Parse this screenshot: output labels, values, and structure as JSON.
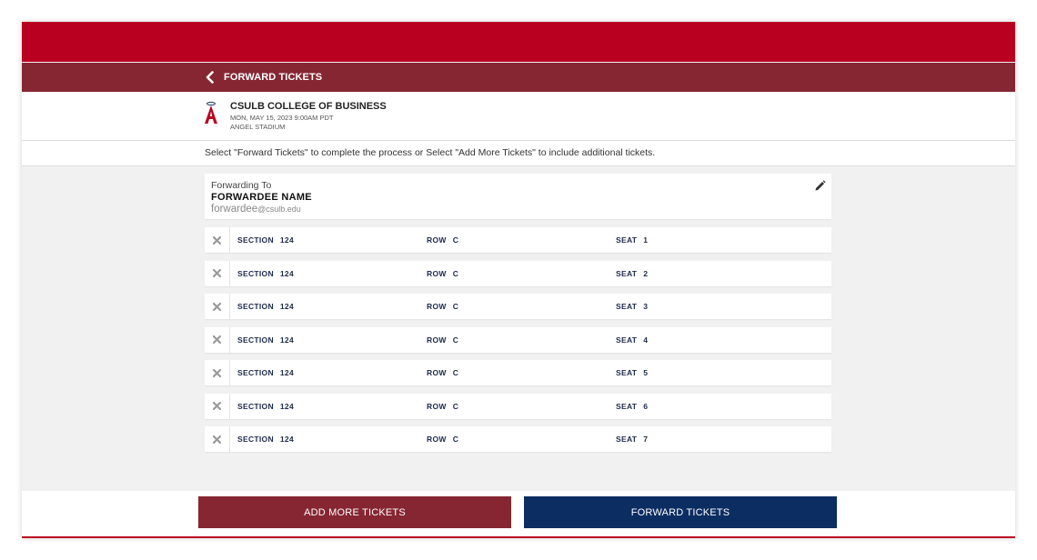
{
  "header": {
    "back_label": "FORWARD TICKETS"
  },
  "event": {
    "title": "CSULB COLLEGE OF BUSINESS",
    "date": "MON, MAY 15, 2023 9:00AM PDT",
    "venue": "ANGEL STADIUM",
    "logo_icon": "angels-a-halo-logo"
  },
  "instructions": "Select \"Forward Tickets\" to complete the process or Select \"Add More Tickets\" to include additional tickets.",
  "forwarding": {
    "label": "Forwarding To",
    "name": "FORWARDEE NAME",
    "email_user": "forwardee",
    "email_domain": "@csulb.edu",
    "edit_icon": "pencil-icon"
  },
  "ticket_labels": {
    "section": "SECTION",
    "row": "ROW",
    "seat": "SEAT"
  },
  "tickets": [
    {
      "section": "124",
      "row": "C",
      "seat": "1"
    },
    {
      "section": "124",
      "row": "C",
      "seat": "2"
    },
    {
      "section": "124",
      "row": "C",
      "seat": "3"
    },
    {
      "section": "124",
      "row": "C",
      "seat": "4"
    },
    {
      "section": "124",
      "row": "C",
      "seat": "5"
    },
    {
      "section": "124",
      "row": "C",
      "seat": "6"
    },
    {
      "section": "124",
      "row": "C",
      "seat": "7"
    }
  ],
  "buttons": {
    "add_more": "ADD MORE TICKETS",
    "forward": "FORWARD TICKETS"
  },
  "colors": {
    "primary_red": "#ba0021",
    "dark_red": "#862633",
    "navy": "#0c2d62"
  }
}
